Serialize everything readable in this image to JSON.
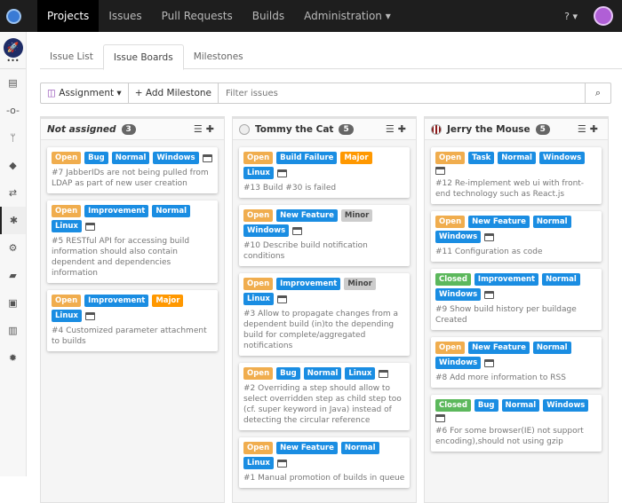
{
  "topnav": {
    "items": [
      "Projects",
      "Issues",
      "Pull Requests",
      "Builds",
      "Administration ▾"
    ],
    "help": "? ▾"
  },
  "tabs": [
    "Issue List",
    "Issue Boards",
    "Milestones"
  ],
  "toolbar": {
    "assignment": "Assignment ▾",
    "add_milestone": "+ Add Milestone",
    "filter_placeholder": "Filter issues"
  },
  "colors": {
    "Open": "#f0ad4e",
    "Closed": "#5cb85c",
    "blue": "#1a8de2",
    "Major": "#ff9800",
    "Minor": "#cccccc"
  },
  "columns": [
    {
      "title": "Not assigned",
      "count": "3",
      "cards": [
        {
          "labels": [
            "Open",
            "Bug",
            "Normal",
            "Windows"
          ],
          "title": "#7 JabberIDs are not being pulled from LDAP as part of new user creation"
        },
        {
          "labels": [
            "Open",
            "Improvement",
            "Normal",
            "Linux"
          ],
          "title": "#5 RESTful API for accessing build information should also contain dependent and dependencies information"
        },
        {
          "labels": [
            "Open",
            "Improvement",
            "Major",
            "Linux"
          ],
          "title": "#4 Customized parameter attachment to builds"
        }
      ]
    },
    {
      "title": "Tommy the Cat",
      "count": "5",
      "cards": [
        {
          "labels": [
            "Open",
            "Build Failure",
            "Major",
            "Linux"
          ],
          "title": "#13 Build #30 is failed"
        },
        {
          "labels": [
            "Open",
            "New Feature",
            "Minor",
            "Windows"
          ],
          "title": "#10 Describe build notification conditions"
        },
        {
          "labels": [
            "Open",
            "Improvement",
            "Minor",
            "Linux"
          ],
          "title": "#3 Allow to propagate changes from a dependent build (in)to the depending build for complete/aggregated notifications"
        },
        {
          "labels": [
            "Open",
            "Bug",
            "Normal",
            "Linux"
          ],
          "title": "#2 Overriding a step should allow to select overridden step as child step too (cf. super keyword in Java) instead of detecting the circular reference"
        },
        {
          "labels": [
            "Open",
            "New Feature",
            "Normal",
            "Linux"
          ],
          "title": "#1 Manual promotion of builds in queue"
        }
      ]
    },
    {
      "title": "Jerry the Mouse",
      "count": "5",
      "cards": [
        {
          "labels": [
            "Open",
            "Task",
            "Normal",
            "Windows"
          ],
          "title": "#12 Re-implement web ui with front-end technology such as React.js"
        },
        {
          "labels": [
            "Open",
            "New Feature",
            "Normal",
            "Windows"
          ],
          "title": "#11 Configuration as code"
        },
        {
          "labels": [
            "Closed",
            "Improvement",
            "Normal",
            "Windows"
          ],
          "title": "#9 Show build history per buildage Created"
        },
        {
          "labels": [
            "Open",
            "New Feature",
            "Normal",
            "Windows"
          ],
          "title": "#8 Add more information to RSS"
        },
        {
          "labels": [
            "Closed",
            "Bug",
            "Normal",
            "Windows"
          ],
          "title": "#6 For some browser(IE) not support encoding),should not using gzip"
        }
      ]
    }
  ]
}
